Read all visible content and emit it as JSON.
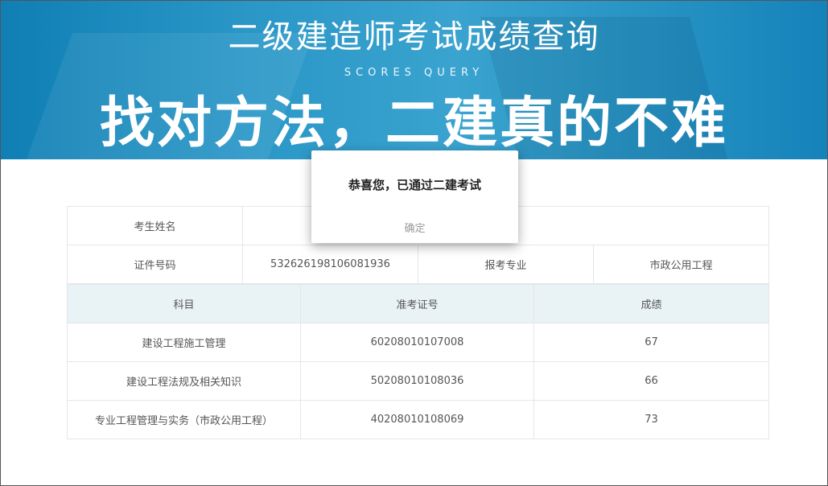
{
  "banner": {
    "title": "二级建造师考试成绩查询",
    "subtitle": "SCORES QUERY",
    "slogan": "找对方法，二建真的不难"
  },
  "info": {
    "name_label": "考生姓名",
    "name_value": "",
    "id_label": "证件号码",
    "id_value": "532626198106081936",
    "major_label": "报考专业",
    "major_value": "市政公用工程"
  },
  "scores": {
    "headers": [
      "科目",
      "准考证号",
      "成绩"
    ],
    "rows": [
      {
        "subject": "建设工程施工管理",
        "ticket": "60208010107008",
        "score": "67"
      },
      {
        "subject": "建设工程法规及相关知识",
        "ticket": "50208010108036",
        "score": "66"
      },
      {
        "subject": "专业工程管理与实务（市政公用工程）",
        "ticket": "40208010108069",
        "score": "73"
      }
    ]
  },
  "modal": {
    "message": "恭喜您，已通过二建考试",
    "confirm": "确定"
  }
}
